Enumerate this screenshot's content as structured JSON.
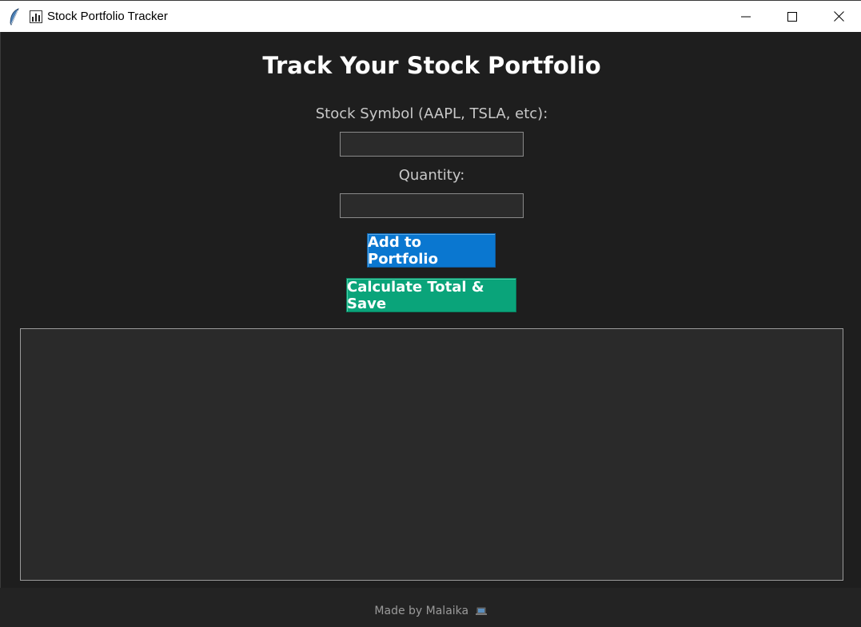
{
  "window": {
    "title": "Stock Portfolio Tracker",
    "icon": "bar-chart-icon",
    "app_icon": "feather-icon",
    "controls": [
      "minimize-icon",
      "maximize-icon",
      "close-icon"
    ]
  },
  "main": {
    "heading": "Track Your Stock Portfolio",
    "symbol_label": "Stock Symbol (AAPL, TSLA, etc):",
    "symbol_value": "",
    "quantity_label": "Quantity:",
    "quantity_value": "",
    "add_button": "Add to Portfolio",
    "calc_button": "Calculate Total & Save",
    "output_text": ""
  },
  "footer": {
    "text": "Made by Malaika",
    "icon": "laptop-icon"
  },
  "colors": {
    "background": "#1e1e1e",
    "add_button": "#0a77d0",
    "calc_button": "#0aa47a",
    "output_bg": "#2a2a2a"
  }
}
